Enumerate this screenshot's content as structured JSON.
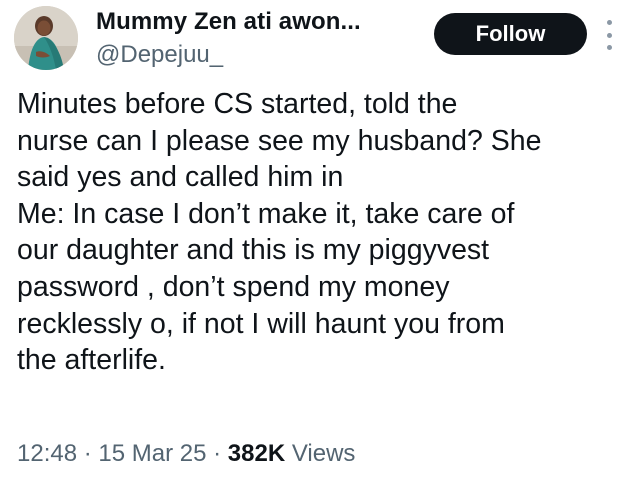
{
  "author": {
    "display_name": "Mummy Zen ati awon...",
    "handle": "@Depejuu_",
    "avatar_icon": "profile-photo"
  },
  "actions": {
    "follow_label": "Follow",
    "more_icon": "more-vertical-icon"
  },
  "tweet": {
    "lines": [
      "Minutes before CS started, told the",
      "nurse can I please see my husband? She",
      "said yes and called him in",
      "Me: In case I don’t make it, take care of",
      "our daughter and this is my piggyvest",
      "password , don’t spend my money",
      "recklessly o, if not I will haunt you from",
      "the afterlife."
    ]
  },
  "meta": {
    "time": "12:48",
    "separator": " · ",
    "date": "15 Mar 25",
    "views_count": "382K",
    "views_label": "Views"
  },
  "colors": {
    "text": "#0f1419",
    "secondary": "#536471",
    "button_bg": "#0f1419",
    "button_text": "#ffffff"
  }
}
